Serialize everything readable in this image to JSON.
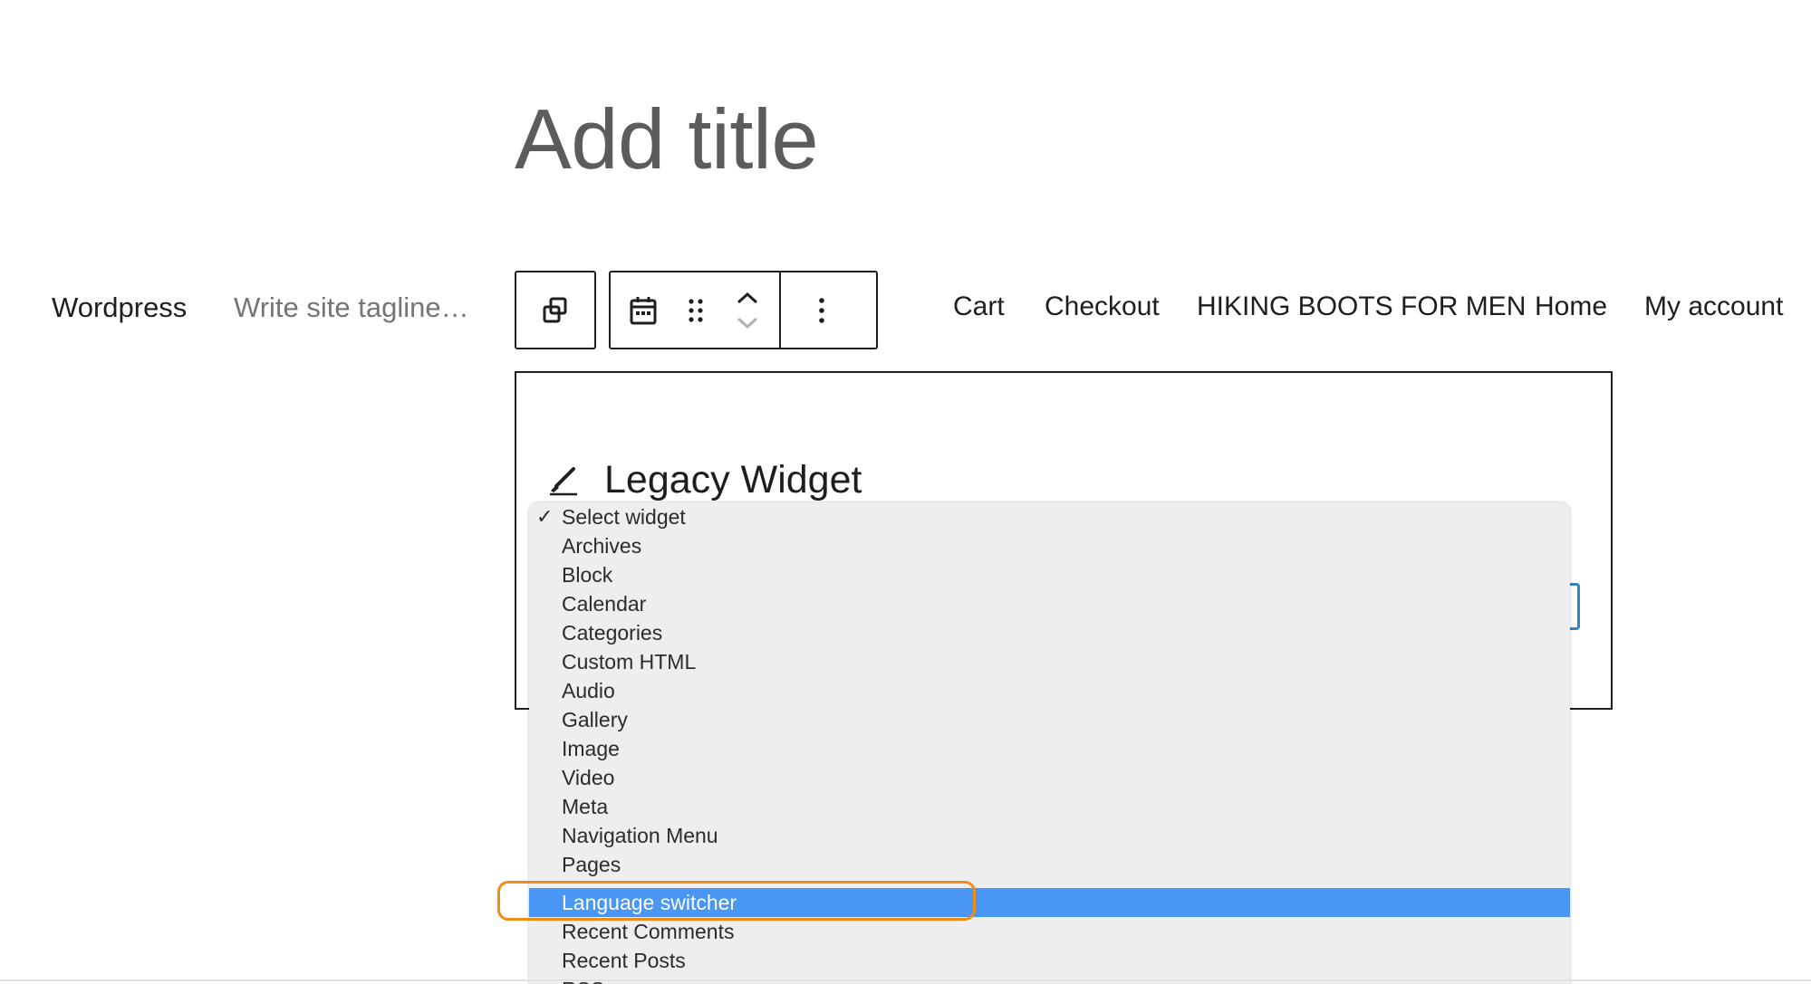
{
  "editor": {
    "post_title_placeholder": "Add title"
  },
  "site": {
    "title": "Wordpress",
    "tagline_placeholder": "Write site tagline…"
  },
  "block_toolbar": {
    "transform_icon": "duplicate-squares-icon",
    "block_type_icon": "calendar-icon",
    "drag_icon": "drag-handle-icon",
    "move_up_icon": "chevron-up-icon",
    "move_down_icon": "chevron-down-icon",
    "options_icon": "more-vertical-icon"
  },
  "nav": {
    "items": [
      "Cart",
      "Checkout",
      "HIKING BOOTS FOR MEN",
      "Home",
      "My account"
    ]
  },
  "legacy_widget": {
    "icon": "brush-icon",
    "title": "Legacy Widget"
  },
  "widget_select": {
    "selected": "Select widget",
    "highlighted": "Language switcher",
    "options": [
      "Select widget",
      "Archives",
      "Block",
      "Calendar",
      "Categories",
      "Custom HTML",
      "Audio",
      "Gallery",
      "Image",
      "Video",
      "Meta",
      "Navigation Menu",
      "Pages",
      "Language switcher",
      "Recent Comments",
      "Recent Posts",
      "RSS"
    ]
  },
  "colors": {
    "highlight_outline": "#f08c18",
    "option_highlight": "#4a96f4",
    "select_border": "#3582c4"
  }
}
